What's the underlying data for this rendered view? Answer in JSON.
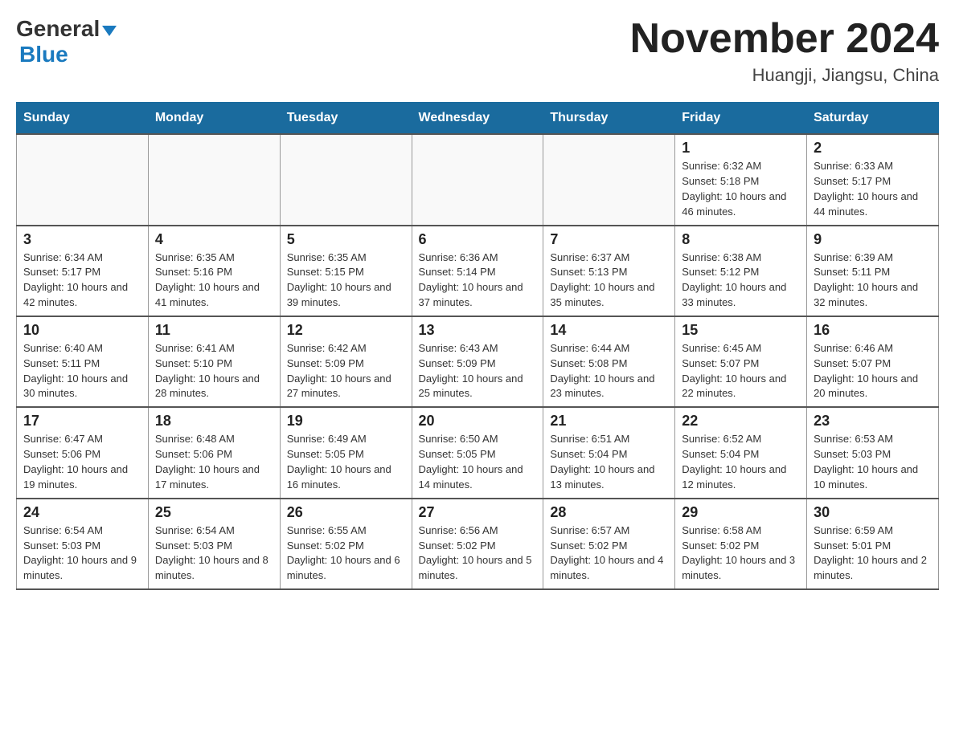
{
  "logo": {
    "general": "General",
    "blue": "Blue"
  },
  "title": "November 2024",
  "location": "Huangji, Jiangsu, China",
  "weekdays": [
    "Sunday",
    "Monday",
    "Tuesday",
    "Wednesday",
    "Thursday",
    "Friday",
    "Saturday"
  ],
  "weeks": [
    [
      {
        "day": "",
        "info": ""
      },
      {
        "day": "",
        "info": ""
      },
      {
        "day": "",
        "info": ""
      },
      {
        "day": "",
        "info": ""
      },
      {
        "day": "",
        "info": ""
      },
      {
        "day": "1",
        "info": "Sunrise: 6:32 AM\nSunset: 5:18 PM\nDaylight: 10 hours and 46 minutes."
      },
      {
        "day": "2",
        "info": "Sunrise: 6:33 AM\nSunset: 5:17 PM\nDaylight: 10 hours and 44 minutes."
      }
    ],
    [
      {
        "day": "3",
        "info": "Sunrise: 6:34 AM\nSunset: 5:17 PM\nDaylight: 10 hours and 42 minutes."
      },
      {
        "day": "4",
        "info": "Sunrise: 6:35 AM\nSunset: 5:16 PM\nDaylight: 10 hours and 41 minutes."
      },
      {
        "day": "5",
        "info": "Sunrise: 6:35 AM\nSunset: 5:15 PM\nDaylight: 10 hours and 39 minutes."
      },
      {
        "day": "6",
        "info": "Sunrise: 6:36 AM\nSunset: 5:14 PM\nDaylight: 10 hours and 37 minutes."
      },
      {
        "day": "7",
        "info": "Sunrise: 6:37 AM\nSunset: 5:13 PM\nDaylight: 10 hours and 35 minutes."
      },
      {
        "day": "8",
        "info": "Sunrise: 6:38 AM\nSunset: 5:12 PM\nDaylight: 10 hours and 33 minutes."
      },
      {
        "day": "9",
        "info": "Sunrise: 6:39 AM\nSunset: 5:11 PM\nDaylight: 10 hours and 32 minutes."
      }
    ],
    [
      {
        "day": "10",
        "info": "Sunrise: 6:40 AM\nSunset: 5:11 PM\nDaylight: 10 hours and 30 minutes."
      },
      {
        "day": "11",
        "info": "Sunrise: 6:41 AM\nSunset: 5:10 PM\nDaylight: 10 hours and 28 minutes."
      },
      {
        "day": "12",
        "info": "Sunrise: 6:42 AM\nSunset: 5:09 PM\nDaylight: 10 hours and 27 minutes."
      },
      {
        "day": "13",
        "info": "Sunrise: 6:43 AM\nSunset: 5:09 PM\nDaylight: 10 hours and 25 minutes."
      },
      {
        "day": "14",
        "info": "Sunrise: 6:44 AM\nSunset: 5:08 PM\nDaylight: 10 hours and 23 minutes."
      },
      {
        "day": "15",
        "info": "Sunrise: 6:45 AM\nSunset: 5:07 PM\nDaylight: 10 hours and 22 minutes."
      },
      {
        "day": "16",
        "info": "Sunrise: 6:46 AM\nSunset: 5:07 PM\nDaylight: 10 hours and 20 minutes."
      }
    ],
    [
      {
        "day": "17",
        "info": "Sunrise: 6:47 AM\nSunset: 5:06 PM\nDaylight: 10 hours and 19 minutes."
      },
      {
        "day": "18",
        "info": "Sunrise: 6:48 AM\nSunset: 5:06 PM\nDaylight: 10 hours and 17 minutes."
      },
      {
        "day": "19",
        "info": "Sunrise: 6:49 AM\nSunset: 5:05 PM\nDaylight: 10 hours and 16 minutes."
      },
      {
        "day": "20",
        "info": "Sunrise: 6:50 AM\nSunset: 5:05 PM\nDaylight: 10 hours and 14 minutes."
      },
      {
        "day": "21",
        "info": "Sunrise: 6:51 AM\nSunset: 5:04 PM\nDaylight: 10 hours and 13 minutes."
      },
      {
        "day": "22",
        "info": "Sunrise: 6:52 AM\nSunset: 5:04 PM\nDaylight: 10 hours and 12 minutes."
      },
      {
        "day": "23",
        "info": "Sunrise: 6:53 AM\nSunset: 5:03 PM\nDaylight: 10 hours and 10 minutes."
      }
    ],
    [
      {
        "day": "24",
        "info": "Sunrise: 6:54 AM\nSunset: 5:03 PM\nDaylight: 10 hours and 9 minutes."
      },
      {
        "day": "25",
        "info": "Sunrise: 6:54 AM\nSunset: 5:03 PM\nDaylight: 10 hours and 8 minutes."
      },
      {
        "day": "26",
        "info": "Sunrise: 6:55 AM\nSunset: 5:02 PM\nDaylight: 10 hours and 6 minutes."
      },
      {
        "day": "27",
        "info": "Sunrise: 6:56 AM\nSunset: 5:02 PM\nDaylight: 10 hours and 5 minutes."
      },
      {
        "day": "28",
        "info": "Sunrise: 6:57 AM\nSunset: 5:02 PM\nDaylight: 10 hours and 4 minutes."
      },
      {
        "day": "29",
        "info": "Sunrise: 6:58 AM\nSunset: 5:02 PM\nDaylight: 10 hours and 3 minutes."
      },
      {
        "day": "30",
        "info": "Sunrise: 6:59 AM\nSunset: 5:01 PM\nDaylight: 10 hours and 2 minutes."
      }
    ]
  ]
}
